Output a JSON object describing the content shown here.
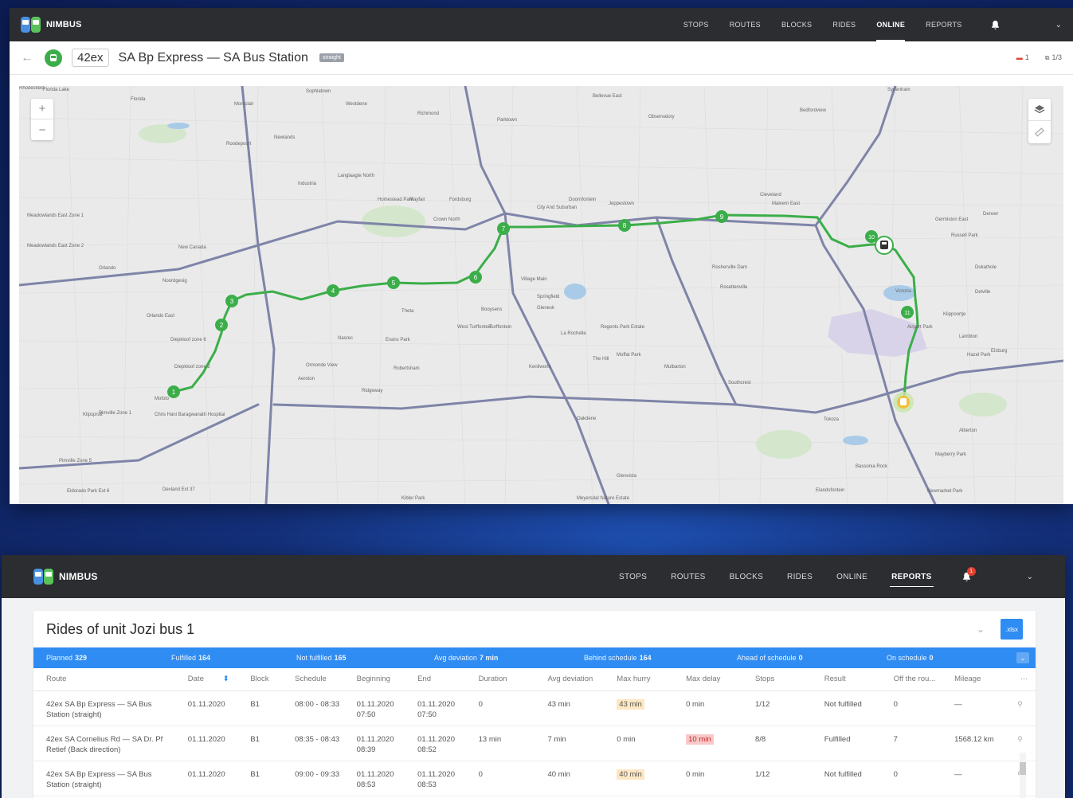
{
  "brand": "NIMBUS",
  "top_nav": [
    "STOPS",
    "ROUTES",
    "BLOCKS",
    "RIDES",
    "ONLINE",
    "REPORTS"
  ],
  "top_nav_active": "ONLINE",
  "route_bar": {
    "code": "42ex",
    "name": "SA Bp Express — SA Bus Station",
    "badge": "straight",
    "alerts_count": "1",
    "buses_count": "1/3"
  },
  "map": {
    "zoom_in": "+",
    "zoom_out": "−",
    "stops": [
      "1",
      "2",
      "3",
      "4",
      "5",
      "6",
      "7",
      "8",
      "9",
      "10",
      "11"
    ],
    "labels": [
      "Florida Lake",
      "Florida",
      "Montclair",
      "Roodepoort",
      "Newlands",
      "Sophiatown",
      "Westdene",
      "Richmond",
      "Parktown",
      "Bellevue East",
      "Observatory",
      "Bedfordview",
      "Sydenham",
      "Germiston East",
      "Langlaagte North",
      "Industria",
      "Homestead Park",
      "Mayfair",
      "Fordsburg",
      "Crown North",
      "City And Suburban",
      "Doornfontein",
      "Jeppestown",
      "Cleveland",
      "Malvern East",
      "Russell Park",
      "Denver",
      "Meadowlands East Zone 1",
      "Meadowlands East Zone 2",
      "New Canada",
      "Orlando",
      "Noordgesig",
      "Orlando East",
      "Diepkloof zone 6",
      "Diepkloof zone 2",
      "Mofolo",
      "Chris Hani Baragwanath Hospital",
      "Pimville Zone 1",
      "Pimville Zone 5",
      "Klipspruit",
      "Eldorado Park Ext 6",
      "Devland Ext 37",
      "Nasrec",
      "Aeroton",
      "Ormonde View",
      "Robertsham",
      "Ridgeway",
      "Evans Park",
      "Theta",
      "Booysens",
      "West Turffontein",
      "Turffontein",
      "La Rochelle",
      "Regents Park Estate",
      "Rosettenville",
      "Village Main",
      "Springfield",
      "Glenesk",
      "Kenilworth",
      "The Hill",
      "Moffat Park",
      "Mulbarton",
      "Oakdene",
      "Rosherville Dam",
      "Victoria",
      "Airport Park",
      "Klippoortje",
      "Dukathole",
      "Delville",
      "Lambton",
      "Hazel Park",
      "Elsburg",
      "Southcrest",
      "Tokoza",
      "Alberton",
      "Mayberry Park",
      "Newmarket Park",
      "Kibler Park",
      "Meyersdal Nature Estate",
      "Glenvista",
      "Bassonia Rock",
      "Elandsfontein",
      "Rhodesfield"
    ]
  },
  "bottom_nav_active": "REPORTS",
  "notifications_count": "1",
  "panel": {
    "title": "Rides of unit Jozi bus 1",
    "export_label": ".xlsx",
    "summary": [
      {
        "label": "Planned",
        "value": "329"
      },
      {
        "label": "Fulfilled",
        "value": "164"
      },
      {
        "label": "Not fulfilled",
        "value": "165"
      },
      {
        "label": "Avg deviation",
        "value": "7 min"
      },
      {
        "label": "Behind schedule",
        "value": "164"
      },
      {
        "label": "Ahead of schedule",
        "value": "0"
      },
      {
        "label": "On schedule",
        "value": "0"
      }
    ],
    "columns": [
      "Route",
      "Date",
      "",
      "Block",
      "Schedule",
      "Beginning",
      "End",
      "Duration",
      "Avg deviation",
      "Max hurry",
      "Max delay",
      "Stops",
      "Result",
      "Off the rou...",
      "Mileage",
      "···"
    ],
    "rows": [
      {
        "route": "42ex SA Bp Express — SA Bus Station (straight)",
        "date": "01.11.2020",
        "block": "B1",
        "schedule": "08:00 - 08:33",
        "beginning": "01.11.2020 07:50",
        "end": "01.11.2020 07:50",
        "duration": "0",
        "avg_deviation": "43 min",
        "max_hurry": "43 min",
        "max_delay": "0 min",
        "stops": "1/12",
        "result": "Not fulfilled",
        "off_route": "0",
        "mileage": "—",
        "hurry_hl": "orange",
        "delay_hl": ""
      },
      {
        "route": "42ex SA Cornelius Rd — SA Dr. Pf Retief (Back direction)",
        "date": "01.11.2020",
        "block": "B1",
        "schedule": "08:35 - 08:43",
        "beginning": "01.11.2020 08:39",
        "end": "01.11.2020 08:52",
        "duration": "13 min",
        "avg_deviation": "7 min",
        "max_hurry": "0 min",
        "max_delay": "10 min",
        "stops": "8/8",
        "result": "Fulfilled",
        "off_route": "7",
        "mileage": "1568.12 km",
        "hurry_hl": "",
        "delay_hl": "red"
      },
      {
        "route": "42ex SA Bp Express — SA Bus Station (straight)",
        "date": "01.11.2020",
        "block": "B1",
        "schedule": "09:00 - 09:33",
        "beginning": "01.11.2020 08:53",
        "end": "01.11.2020 08:53",
        "duration": "0",
        "avg_deviation": "40 min",
        "max_hurry": "40 min",
        "max_delay": "0 min",
        "stops": "1/12",
        "result": "Not fulfilled",
        "off_route": "0",
        "mileage": "—",
        "hurry_hl": "orange",
        "delay_hl": ""
      }
    ]
  },
  "colors": {
    "nav_bg": "#2b2d30",
    "route_green": "#3bae49",
    "accent_blue": "#2f8cf2",
    "bus_yellow": "#f2c037"
  }
}
